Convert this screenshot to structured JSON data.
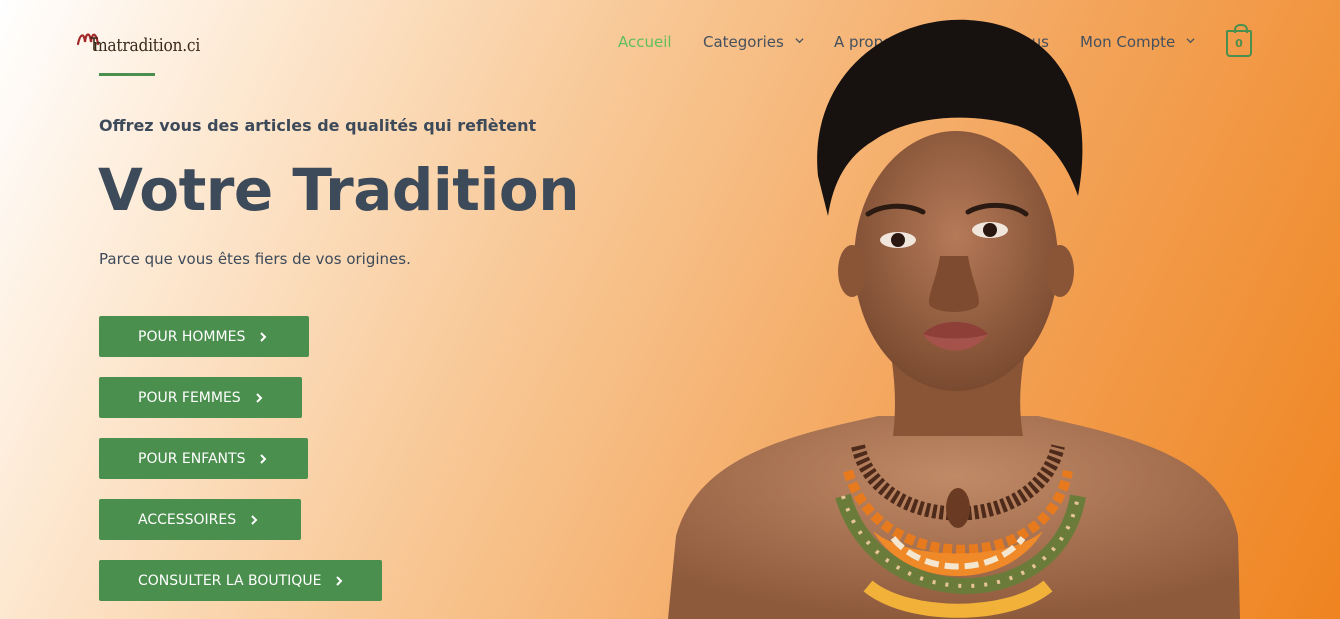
{
  "header": {
    "logo_text": "matradition.ci",
    "nav": [
      {
        "label": "Accueil",
        "active": true
      },
      {
        "label": "Categories",
        "dropdown": true
      },
      {
        "label": "A propos"
      },
      {
        "label": "Contactez Nous"
      },
      {
        "label": "Mon Compte",
        "dropdown": true
      }
    ],
    "cart_count": "0"
  },
  "hero": {
    "tagline": "Offrez vous des articles de qualités qui reflètent",
    "headline": "Votre Tradition",
    "subline": "Parce que vous êtes fiers de vos origines."
  },
  "buttons": [
    {
      "label": "POUR HOMMES"
    },
    {
      "label": "POUR FEMMES"
    },
    {
      "label": "POUR ENFANTS"
    },
    {
      "label": "ACCESSOIRES"
    },
    {
      "label": "CONSULTER LA BOUTIQUE"
    }
  ],
  "colors": {
    "accent_green": "#4a8f4e",
    "active_nav": "#5fbf5a",
    "text_dark": "#3d4a5a",
    "background_orange": "#ef8420"
  },
  "icons": [
    "chevron-down-icon",
    "chevron-right-icon",
    "shopping-bag-icon"
  ]
}
